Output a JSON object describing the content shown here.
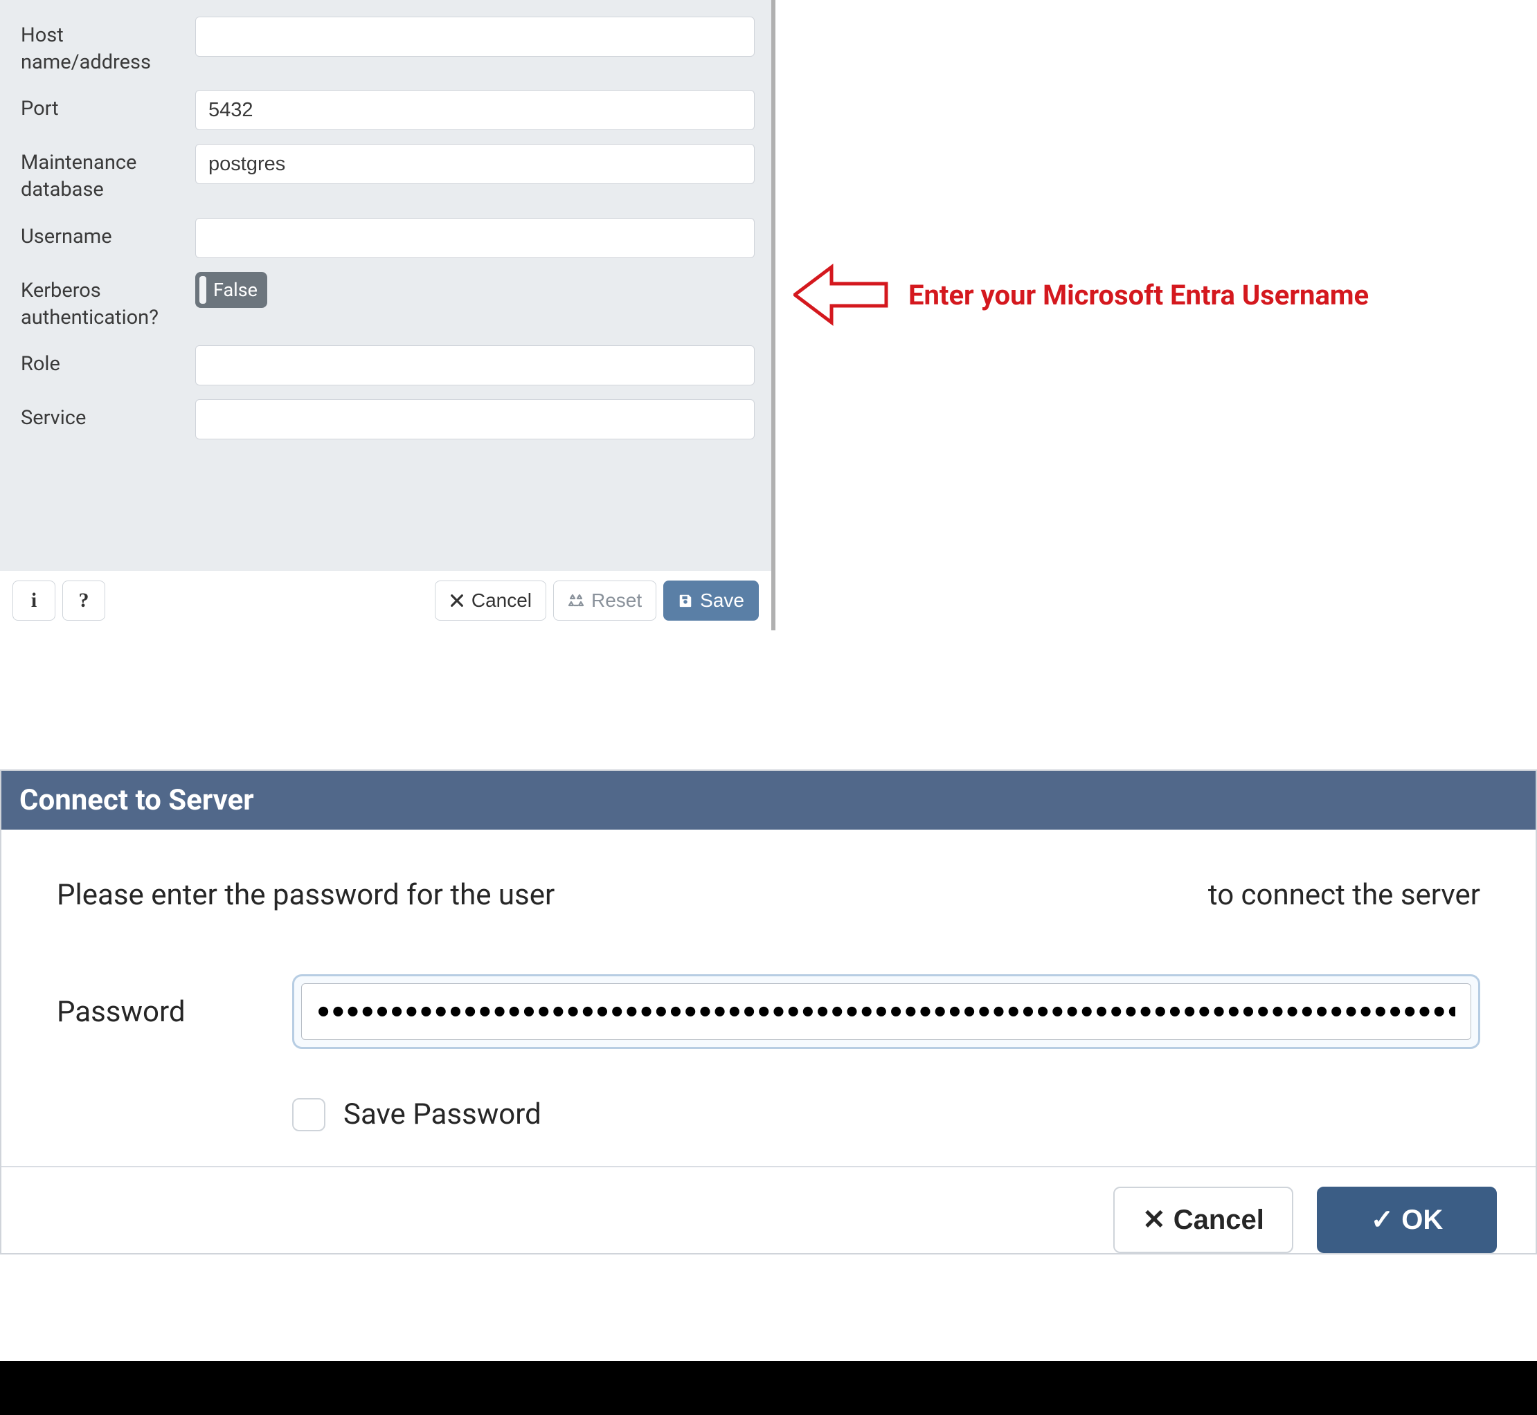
{
  "form": {
    "host_label": "Host name/address",
    "host_value": "",
    "port_label": "Port",
    "port_value": "5432",
    "maintdb_label": "Maintenance database",
    "maintdb_value": "postgres",
    "username_label": "Username",
    "username_value": "",
    "kerberos_label": "Kerberos authentication?",
    "kerberos_value": "False",
    "role_label": "Role",
    "role_value": "",
    "service_label": "Service",
    "service_value": ""
  },
  "footer": {
    "info": "i",
    "help": "?",
    "cancel": "Cancel",
    "reset": "Reset",
    "save": "Save"
  },
  "annotation": {
    "text": "Enter your Microsoft Entra Username"
  },
  "connect": {
    "title": "Connect to Server",
    "msg_left": "Please enter the password for the user",
    "msg_right": "to connect the server",
    "password_label": "Password",
    "password_value": "••••••••••••••••••••••••••••••••••••••••••••••••••••••••••••••••••••••••••••••••••••••••••",
    "save_password_label": "Save Password",
    "cancel": "✕ Cancel",
    "ok": "✓ OK"
  }
}
